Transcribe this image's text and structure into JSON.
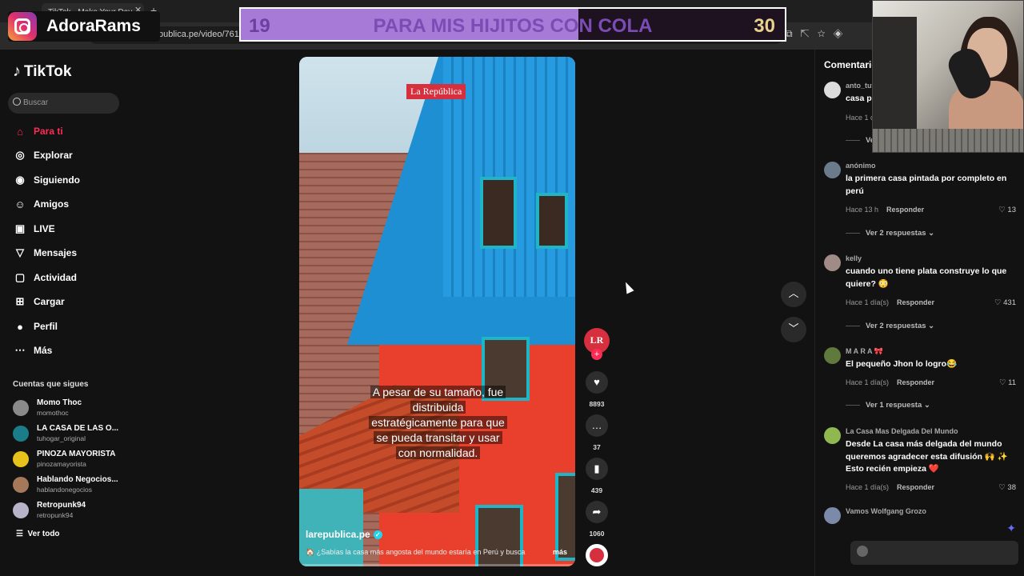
{
  "browser": {
    "tab_title": "TikTok - Make Your Day",
    "url": "publica.pe/video/76101"
  },
  "overlay": {
    "channel": "AdoraRams",
    "goal_start": "19",
    "goal_title": "PARA MIS HIJITOS CON COLA",
    "goal_end": "30",
    "goal_progress": 0.62
  },
  "sidebar": {
    "logo": "TikTok",
    "search_placeholder": "Buscar",
    "nav": [
      {
        "label": "Para ti",
        "icon": "home-icon"
      },
      {
        "label": "Explorar",
        "icon": "compass-icon"
      },
      {
        "label": "Siguiendo",
        "icon": "following-icon"
      },
      {
        "label": "Amigos",
        "icon": "friends-icon"
      },
      {
        "label": "LIVE",
        "icon": "live-icon"
      },
      {
        "label": "Mensajes",
        "icon": "messages-icon"
      },
      {
        "label": "Actividad",
        "icon": "activity-icon"
      },
      {
        "label": "Cargar",
        "icon": "upload-icon"
      },
      {
        "label": "Perfil",
        "icon": "profile-icon"
      },
      {
        "label": "Más",
        "icon": "more-icon"
      }
    ],
    "following_heading": "Cuentas que sigues",
    "accounts": [
      {
        "name": "Momo Thoc",
        "handle": "momothoc",
        "color": "#8a8a8a"
      },
      {
        "name": "LA CASA DE LAS O...",
        "handle": "tuhogar_original",
        "color": "#1b7c8a"
      },
      {
        "name": "PINOZA MAYORISTA",
        "handle": "pinozamayorista",
        "color": "#e7c21a"
      },
      {
        "name": "Hablando Negocios...",
        "handle": "hablandonegocios",
        "color": "#a5785a"
      },
      {
        "name": "Retropunk94",
        "handle": "retropunk94",
        "color": "#b8b3c9"
      }
    ],
    "see_all": "Ver todo"
  },
  "video": {
    "brand_badge": "La República",
    "caption": [
      "A pesar de su tamaño, fue",
      "distribuida",
      "estratégicamente para que",
      "se pueda transitar y usar",
      "con normalidad."
    ],
    "author": "larepublica.pe",
    "description": "🏠 ¿Sabías la casa más angosta del mundo estaría en Perú y busca",
    "more": "más"
  },
  "actions": {
    "avatar_text": "LR",
    "likes": "8893",
    "comments": "37",
    "saves": "439",
    "shares": "1060"
  },
  "comments": {
    "title": "Comentarios",
    "items": [
      {
        "user": "anto_tut",
        "text": "casa pr",
        "time": "Hace 1 d",
        "reply": "",
        "likes": "",
        "more": "Ve",
        "avatar": "#dcdcdc"
      },
      {
        "user": "anónimo",
        "text": "la primera casa pintada por completo en perú",
        "time": "Hace 13 h",
        "reply": "Responder",
        "likes": "13",
        "more": "Ver 2 respuestas",
        "avatar": "#6b7b8c"
      },
      {
        "user": "kelly",
        "text": "cuando uno tiene plata construye lo que quiere? 😳",
        "time": "Hace 1 día(s)",
        "reply": "Responder",
        "likes": "431",
        "more": "Ver 2 respuestas",
        "avatar": "#a18b86"
      },
      {
        "user": "M A R A 🎀",
        "text": "El pequeño Jhon lo logro😂",
        "time": "Hace 1 día(s)",
        "reply": "Responder",
        "likes": "11",
        "more": "Ver 1 respuesta",
        "avatar": "#5f7a3c"
      },
      {
        "user": "La Casa Mas Delgada Del Mundo",
        "text": "Desde La casa más delgada del mundo queremos agradecer esta difusión 🙌 ✨ Esto recién empieza ❤️",
        "time": "Hace 1 día(s)",
        "reply": "Responder",
        "likes": "38",
        "more": "",
        "avatar": "#8fb850"
      },
      {
        "user": "Vamos Wolfgang Grozo",
        "text": "",
        "time": "",
        "reply": "",
        "likes": "",
        "more": "",
        "avatar": "#7a8aa8"
      }
    ]
  }
}
